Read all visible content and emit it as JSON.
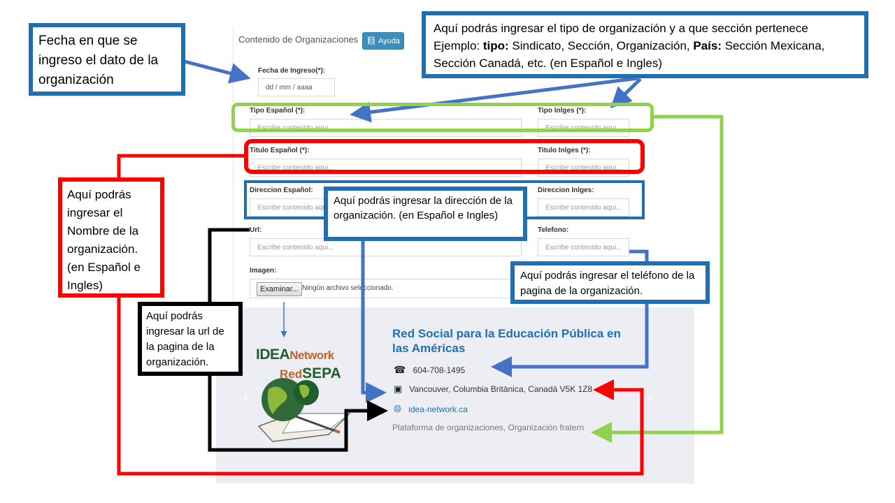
{
  "form": {
    "title": "Contenido de Organizaciones",
    "help_label": "Ayuda",
    "fecha_label": "Fecha de Ingreso(*):",
    "fecha_placeholder": "dd / mm / aaaa",
    "tipo_es_label": "Tipo Español (*):",
    "tipo_en_label": "Tipo Inlges (*):",
    "titulo_es_label": "Titulo Español (*):",
    "titulo_en_label": "Titulo Inlges (*):",
    "direccion_es_label": "Direccion Español:",
    "direccion_en_label": "Direccion Inlges:",
    "url_label": "Url:",
    "telefono_label": "Telefono:",
    "imagen_label": "Imagen:",
    "placeholder": "Escribe contenido aqui...",
    "file_button": "Examinar...",
    "file_status": "Ningún archivo seleccionado."
  },
  "card": {
    "title": "Red Social para la Educación Pública en las Américas",
    "phone": "604-708-1495",
    "address": "Vancouver, Columbia Británica, Canadá V5K 1Z8",
    "website": "idea-network.ca",
    "categories": "Plataforma de organizaciones, Organización fratern",
    "logo_line1_a": "IDEA",
    "logo_line1_b": "Network",
    "logo_line2_a": "Red",
    "logo_line2_b": "SEPA"
  },
  "callouts": {
    "fecha": "Fecha en que se ingreso el dato de la organización",
    "tipo_intro": "Aquí podrás ingresar el tipo de organización y a que sección pertenece Ejemplo: ",
    "tipo_kw1": "tipo:",
    "tipo_mid": " Sindicato, Sección, Organización, ",
    "tipo_kw2": "País:",
    "tipo_end": " Sección Mexicana, Sección Canadá, etc. (en Español e Ingles)",
    "nombre": "Aquí podrás ingresar el Nombre de la organización. (en Español e Ingles)",
    "direccion": "Aquí podrás ingresar la dirección de la organización. (en Español e Ingles)",
    "telefono": "Aquí podrás ingresar el teléfono de la pagina de la organización.",
    "url": "Aquí podrás ingresar la url de la pagina de la organización."
  },
  "colors": {
    "blue_callout": "#1f6fb2",
    "arrow_blue": "#4472c4",
    "green": "#92d050",
    "red": "#ff0000",
    "link": "#1f6fb2"
  }
}
